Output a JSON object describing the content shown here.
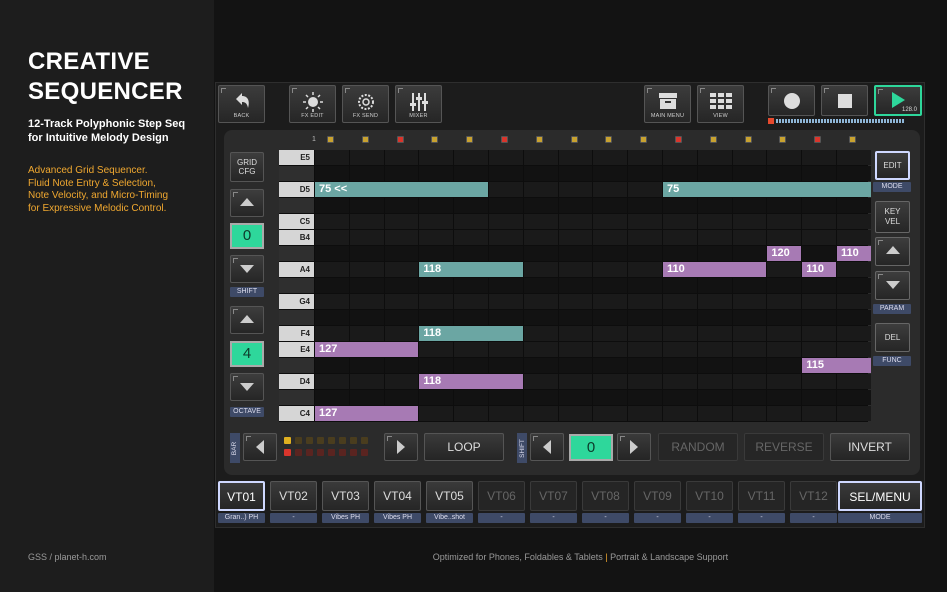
{
  "promo": {
    "title_line1": "CREATIVE",
    "title_line2": "SEQUENCER",
    "subtitle_line1": "12-Track Polyphonic Step Seq",
    "subtitle_line2": "for Intuitive Melody Design",
    "desc_line1": "Advanced Grid Sequencer.",
    "desc_line2": "Fluid Note Entry & Selection,",
    "desc_line3": "Note Velocity, and Micro-Timing",
    "desc_line4": "for Expressive Melodic Control.",
    "footer_left": "GSS / planet-h.com",
    "footer_center_a": "Optimized for Phones, Foldables & Tablets",
    "footer_center_sep": "|",
    "footer_center_b": "Portrait & Landscape Support"
  },
  "toolbar": {
    "back": "BACK",
    "fx_edit": "FX EDIT",
    "fx_send": "FX SEND",
    "mixer": "MIXER",
    "main_menu": "MAIN MENU",
    "view": "VIEW",
    "tempo": "128.0",
    "record_icon": "record-icon",
    "stop_icon": "stop-icon",
    "play_icon": "play-icon"
  },
  "grid": {
    "first_column_number": "1",
    "rows": [
      {
        "note": "E5",
        "white": true
      },
      {
        "note": "",
        "white": false
      },
      {
        "note": "D5",
        "white": true
      },
      {
        "note": "",
        "white": false
      },
      {
        "note": "C5",
        "white": true
      },
      {
        "note": "B4",
        "white": true
      },
      {
        "note": "",
        "white": false
      },
      {
        "note": "A4",
        "white": true
      },
      {
        "note": "",
        "white": false
      },
      {
        "note": "G4",
        "white": true
      },
      {
        "note": "",
        "white": false
      },
      {
        "note": "F4",
        "white": true
      },
      {
        "note": "E4",
        "white": true
      },
      {
        "note": "",
        "white": false
      },
      {
        "note": "D4",
        "white": true
      },
      {
        "note": "",
        "white": false
      },
      {
        "note": "C4",
        "white": true
      }
    ],
    "notes": [
      {
        "row": 2,
        "start": 0,
        "len": 5,
        "label": "75 <<",
        "color": "teal"
      },
      {
        "row": 2,
        "start": 10,
        "len": 6,
        "label": "75",
        "color": "teal"
      },
      {
        "row": 6,
        "start": 13,
        "len": 1,
        "label": "120",
        "color": "purp"
      },
      {
        "row": 6,
        "start": 15,
        "len": 1,
        "label": "110",
        "color": "purp"
      },
      {
        "row": 7,
        "start": 3,
        "len": 3,
        "label": "118",
        "color": "teal"
      },
      {
        "row": 7,
        "start": 10,
        "len": 3,
        "label": "110",
        "color": "purp"
      },
      {
        "row": 7,
        "start": 14,
        "len": 1,
        "label": "110",
        "color": "purp"
      },
      {
        "row": 11,
        "start": 3,
        "len": 3,
        "label": "118",
        "color": "teal"
      },
      {
        "row": 12,
        "start": 0,
        "len": 3,
        "label": "127",
        "color": "purp"
      },
      {
        "row": 13,
        "start": 14,
        "len": 2,
        "label": "115",
        "color": "purp"
      },
      {
        "row": 14,
        "start": 3,
        "len": 3,
        "label": "118",
        "color": "purp"
      },
      {
        "row": 16,
        "start": 0,
        "len": 3,
        "label": "127",
        "color": "purp"
      }
    ],
    "column_markers": [
      "yellow",
      "yellow",
      "red",
      "yellow",
      "yellow",
      "red",
      "yellow",
      "yellow",
      "yellow",
      "yellow",
      "red",
      "yellow",
      "yellow",
      "yellow",
      "red",
      "yellow"
    ]
  },
  "left_controls": {
    "grid_cfg_line1": "GRID",
    "grid_cfg_line2": "CFG",
    "shift_value": "0",
    "shift_label": "SHIFT",
    "octave_value": "4",
    "octave_label": "OCTAVE"
  },
  "right_controls": {
    "edit": "EDIT",
    "mode": "MODE",
    "key_line1": "KEY",
    "key_line2": "VEL",
    "param": "PARAM",
    "del": "DEL",
    "func": "FUNC"
  },
  "bottom_bar": {
    "bar_label": "BAR",
    "loop": "LOOP",
    "shift_label": "SHIFT",
    "shift_value": "0",
    "random": "RANDOM",
    "reverse": "REVERSE",
    "invert": "INVERT"
  },
  "tracks": [
    {
      "id": "VT01",
      "sub": "Gran..) PH",
      "state": "active"
    },
    {
      "id": "VT02",
      "sub": "-",
      "state": "normal"
    },
    {
      "id": "VT03",
      "sub": "Vibes PH",
      "state": "normal"
    },
    {
      "id": "VT04",
      "sub": "Vibes PH",
      "state": "normal"
    },
    {
      "id": "VT05",
      "sub": "Vibe..shot",
      "state": "normal"
    },
    {
      "id": "VT06",
      "sub": "-",
      "state": "dim"
    },
    {
      "id": "VT07",
      "sub": "-",
      "state": "dim"
    },
    {
      "id": "VT08",
      "sub": "-",
      "state": "dim"
    },
    {
      "id": "VT09",
      "sub": "-",
      "state": "dim"
    },
    {
      "id": "VT10",
      "sub": "-",
      "state": "dim"
    },
    {
      "id": "VT11",
      "sub": "-",
      "state": "dim"
    },
    {
      "id": "VT12",
      "sub": "-",
      "state": "dim"
    }
  ],
  "sel_menu": {
    "label": "SEL/MENU",
    "sub": "MODE"
  },
  "colors": {
    "teal_note": "#6ba6a3",
    "purple_note": "#a77ab4",
    "accent_green": "#2ed79b",
    "tag_blue": "#3e4a67",
    "promo_orange": "#f0a830"
  }
}
